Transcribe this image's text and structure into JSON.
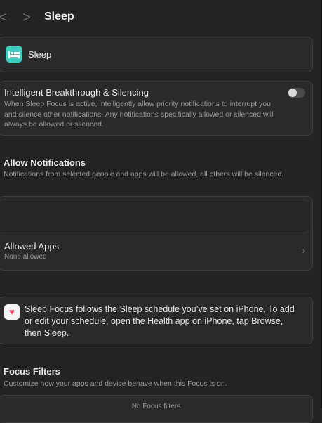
{
  "header": {
    "back_glyph": "<",
    "forward_glyph": ">",
    "title": "Sleep"
  },
  "focus_card": {
    "icon": "bed-icon",
    "icon_color": "#3ad0c0",
    "label": "Sleep"
  },
  "intelligent_breakthrough": {
    "title": "Intelligent Breakthrough & Silencing",
    "description": "When Sleep Focus is active, intelligently allow priority notifications to interrupt you and silence other notifications. Any notifications specifically allowed or silenced will always be allowed or silenced.",
    "enabled": false
  },
  "allow_notifications": {
    "title": "Allow Notifications",
    "description": "Notifications from selected people and apps will be allowed, all others will be silenced."
  },
  "allowed_apps": {
    "title": "Allowed Apps",
    "subtitle": "None allowed",
    "chevron": "›"
  },
  "health_note": {
    "icon": "heart-icon",
    "text": "Sleep Focus follows the Sleep schedule you’ve set on iPhone. To add or edit your schedule, open the Health app on iPhone, tap Browse, then Sleep."
  },
  "focus_filters": {
    "title": "Focus Filters",
    "description": "Customize how your apps and device behave when this Focus is on.",
    "empty_text": "No Focus filters"
  }
}
